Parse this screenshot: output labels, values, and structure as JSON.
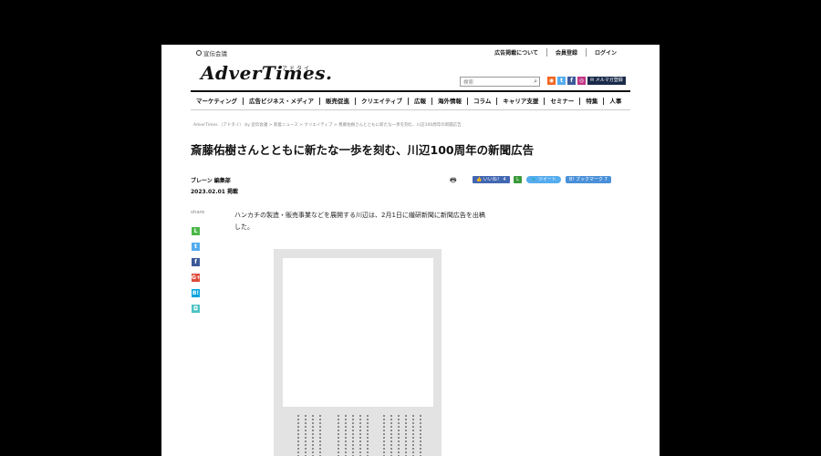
{
  "site": {
    "small_brand": "宣伝会議",
    "logo": "AdverTimes.",
    "logo_kana": "アドタイ"
  },
  "top_links": [
    "広告掲載について",
    "会員登録",
    "ログイン"
  ],
  "search": {
    "placeholder": "検索"
  },
  "social_icons": [
    {
      "name": "rss-icon",
      "glyph": "◉",
      "color": "#f26522"
    },
    {
      "name": "twitter-icon",
      "glyph": "t",
      "color": "#55acee"
    },
    {
      "name": "facebook-icon",
      "glyph": "f",
      "color": "#3b5998"
    },
    {
      "name": "instagram-icon",
      "glyph": "◎",
      "color": "#c13584"
    }
  ],
  "newsletter_label": "✉ メルマガ登録",
  "nav": [
    "マーケティング",
    "広告ビジネス・メディア",
    "販売促進",
    "クリエイティブ",
    "広報",
    "海外情報",
    "コラム",
    "キャリア支援",
    "セミナー",
    "特集",
    "人事"
  ],
  "breadcrumb": "AdverTimes.（アドタイ） by 宣伝会議 > 新着ニュース > クリエイティブ > 斎藤佑樹さんとともに新たな一歩を刻む、川辺100周年の新聞広告",
  "article": {
    "title": "斎藤佑樹さんとともに新たな一歩を刻む、川辺100周年の新聞広告",
    "author": "ブレーン 編集部",
    "date": "2023.02.01 掲載",
    "body": "ハンカチの製造・販売事業などを展開する川辺は、2月1日に繊研新聞に新聞広告を出稿した。"
  },
  "share_buttons": {
    "print_icon": "🖶",
    "like": "👍 いいね！ 4",
    "line": "L",
    "tweet": "🐦 ツイート",
    "hatena": "B! ブックマーク 7"
  },
  "share_sidebar": {
    "label": "share",
    "icons": [
      {
        "name": "line-share-icon",
        "glyph": "L",
        "color": "#4cb848"
      },
      {
        "name": "twitter-share-icon",
        "glyph": "t",
        "color": "#55acee"
      },
      {
        "name": "facebook-share-icon",
        "glyph": "f",
        "color": "#3b5998"
      },
      {
        "name": "google-plus-share-icon",
        "glyph": "G+",
        "color": "#dd4b39"
      },
      {
        "name": "hatena-share-icon",
        "glyph": "B!",
        "color": "#00a4de"
      },
      {
        "name": "pocket-share-icon",
        "glyph": "◘",
        "color": "#4cc2c4"
      }
    ]
  }
}
